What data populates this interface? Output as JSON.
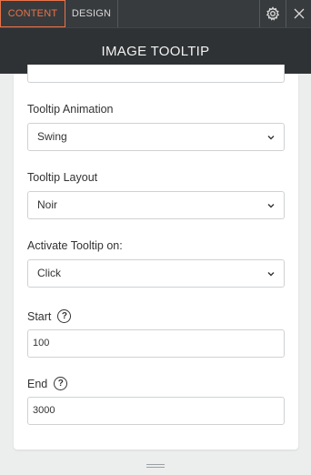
{
  "tabs": {
    "content": "CONTENT",
    "design": "DESIGN"
  },
  "icons": {
    "settings": "gear-icon",
    "close": "close-icon",
    "dropdown": "chevron-down-icon",
    "help": "help-circle-icon",
    "resize": "drag-handle-icon"
  },
  "colors": {
    "accent": "#e8734a",
    "topbar": "#383b3d",
    "titlebar": "#2f3234"
  },
  "header": {
    "title": "IMAGE TOOLTIP"
  },
  "fields": {
    "animation": {
      "label": "Tooltip Animation",
      "value": "Swing"
    },
    "layout": {
      "label": "Tooltip Layout",
      "value": "Noir"
    },
    "activate": {
      "label": "Activate Tooltip on:",
      "value": "Click"
    },
    "start": {
      "label": "Start",
      "help": "?",
      "value": "100"
    },
    "end": {
      "label": "End",
      "help": "?",
      "value": "3000"
    }
  }
}
